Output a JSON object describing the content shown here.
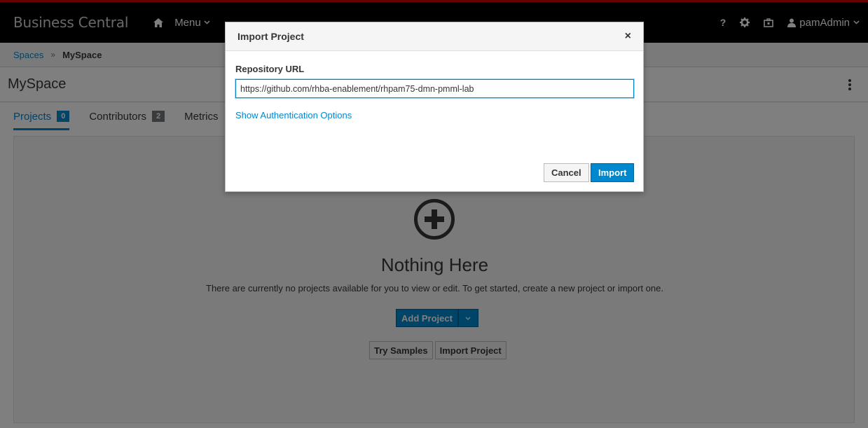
{
  "navbar": {
    "brand": "Business Central",
    "menu_label": "Menu",
    "help_label": "?",
    "user_name": "pamAdmin"
  },
  "breadcrumb": {
    "spaces": "Spaces",
    "current": "MySpace"
  },
  "page": {
    "title": "MySpace"
  },
  "tabs": [
    {
      "label": "Projects",
      "count": "0"
    },
    {
      "label": "Contributors",
      "count": "2"
    },
    {
      "label": "Metrics"
    }
  ],
  "empty_state": {
    "title": "Nothing Here",
    "message": "There are currently no projects available for you to view or edit. To get started, create a new project or import one.",
    "add_project": "Add Project",
    "try_samples": "Try Samples",
    "import_project": "Import Project"
  },
  "modal": {
    "title": "Import Project",
    "close": "×",
    "field_label": "Repository URL",
    "url_value": "https://github.com/rhba-enablement/rhpam75-dmn-pmml-lab",
    "auth_link": "Show Authentication Options",
    "cancel": "Cancel",
    "import": "Import"
  },
  "colors": {
    "accent": "#0088ce",
    "navbar": "#000000",
    "navbar_top_border": "#cc0000"
  }
}
